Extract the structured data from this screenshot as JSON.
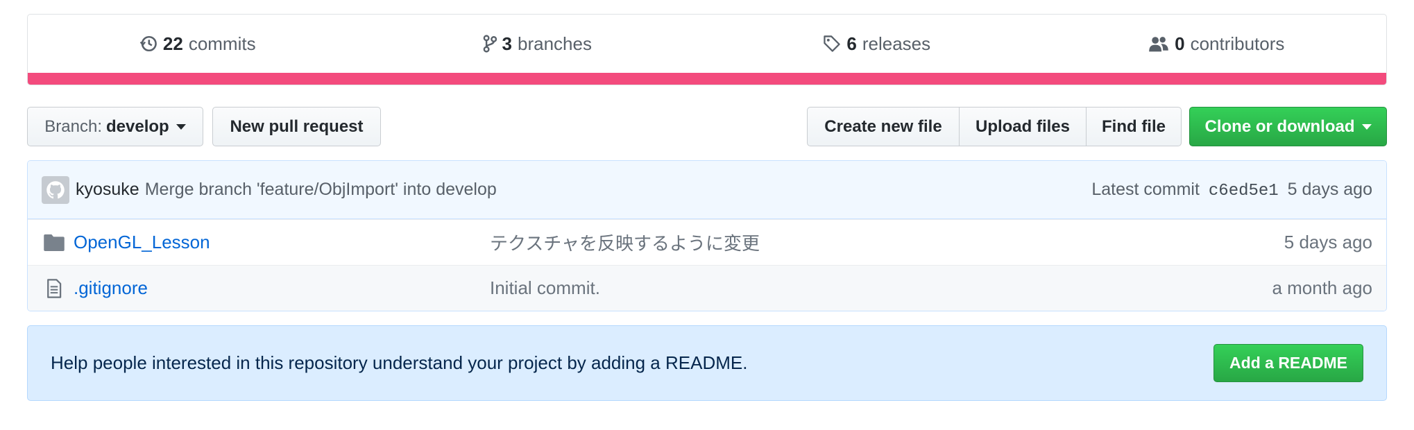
{
  "summary": {
    "commits": {
      "count": "22",
      "label": "commits",
      "icon": "history-icon"
    },
    "branches": {
      "count": "3",
      "label": "branches",
      "icon": "git-branch-icon"
    },
    "releases": {
      "count": "6",
      "label": "releases",
      "icon": "tag-icon"
    },
    "contributors": {
      "count": "0",
      "label": "contributors",
      "icon": "people-icon"
    },
    "language_bar_color": "#f34b7d"
  },
  "toolbar": {
    "branch_prefix": "Branch:",
    "branch_name": "develop",
    "new_pull_request": "New pull request",
    "create_new_file": "Create new file",
    "upload_files": "Upload files",
    "find_file": "Find file",
    "clone_or_download": "Clone or download"
  },
  "latest_commit": {
    "author": "kyosuke",
    "message": "Merge branch 'feature/ObjImport' into develop",
    "prefix": "Latest commit",
    "sha": "c6ed5e1",
    "age": "5 days ago"
  },
  "files": [
    {
      "type": "folder",
      "name": "OpenGL_Lesson",
      "message": "テクスチャを反映するように変更",
      "age": "5 days ago",
      "icon": "folder-icon"
    },
    {
      "type": "file",
      "name": ".gitignore",
      "message": "Initial commit.",
      "age": "a month ago",
      "icon": "file-icon"
    }
  ],
  "readme_prompt": {
    "text": "Help people interested in this repository understand your project by adding a README.",
    "button": "Add a README"
  },
  "colors": {
    "link": "#0366d6",
    "green": "#28a745",
    "commit_bg": "#f1f8ff",
    "readme_bg": "#dbedff"
  }
}
